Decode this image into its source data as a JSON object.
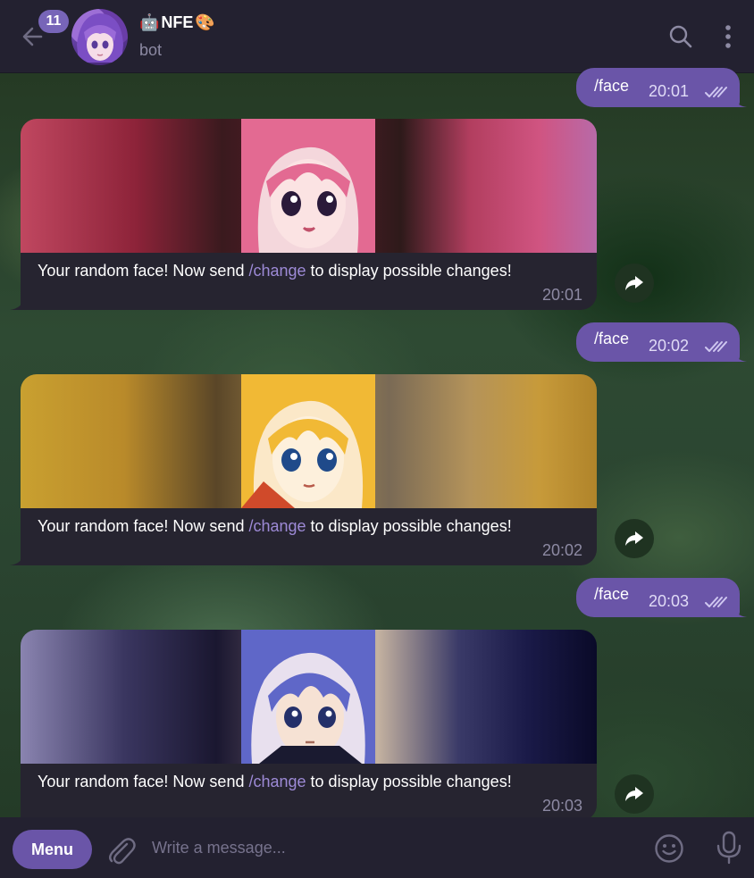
{
  "header": {
    "unread_count": "11",
    "title": "NFE",
    "title_prefix_emoji": "🤖",
    "title_suffix_emoji": "🎨",
    "subtitle": "bot",
    "icons": [
      "back-arrow-icon",
      "search-icon",
      "more-vertical-icon"
    ]
  },
  "messages": [
    {
      "type": "outgoing",
      "text": "/face",
      "time": "20:01",
      "status": "read"
    },
    {
      "type": "incoming_photo",
      "caption_prefix": "Your random face! Now send ",
      "caption_command": "/change",
      "caption_suffix": " to display possible changes!",
      "time": "20:01",
      "hair_color": "#e36a92"
    },
    {
      "type": "outgoing",
      "text": "/face",
      "time": "20:02",
      "status": "read"
    },
    {
      "type": "incoming_photo",
      "caption_prefix": "Your random face! Now send ",
      "caption_command": "/change",
      "caption_suffix": " to display possible changes!",
      "time": "20:02",
      "hair_color": "#f1b935"
    },
    {
      "type": "outgoing",
      "text": "/face",
      "time": "20:03",
      "status": "read"
    },
    {
      "type": "incoming_photo",
      "caption_prefix": "Your random face! Now send ",
      "caption_command": "/change",
      "caption_suffix": " to display possible changes!",
      "time": "20:03",
      "hair_color": "#5f67c8"
    }
  ],
  "composer": {
    "menu_label": "Menu",
    "placeholder": "Write a message...",
    "icons": [
      "paperclip-icon",
      "emoji-icon",
      "microphone-icon"
    ]
  },
  "colors": {
    "accent": "#6a55a8",
    "header_bg": "#232130",
    "incoming_bubble": "#262430",
    "command_link": "#9d8ad6"
  }
}
